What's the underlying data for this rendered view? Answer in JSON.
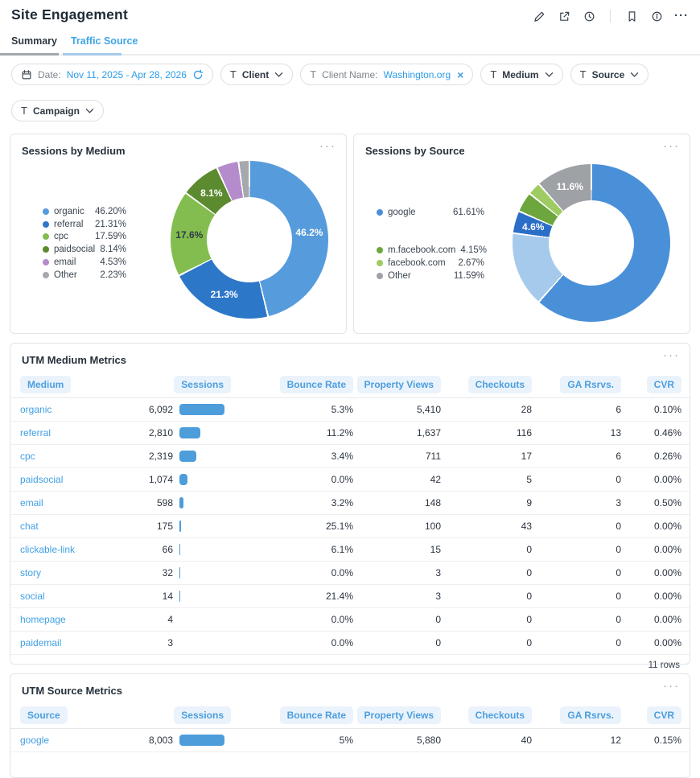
{
  "header": {
    "title": "Site Engagement",
    "more_glyph": "···"
  },
  "tabs": [
    {
      "label": "Summary",
      "active": false
    },
    {
      "label": "Traffic Source",
      "active": true
    }
  ],
  "filters": {
    "date": {
      "label": "Date:",
      "value": "Nov 11, 2025 - Apr 28, 2026"
    },
    "client": {
      "label": "Client"
    },
    "client_name": {
      "label": "Client Name:",
      "value": "Washington.org",
      "close_glyph": "×"
    },
    "medium": {
      "label": "Medium"
    },
    "source": {
      "label": "Source"
    },
    "campaign": {
      "label": "Campaign"
    },
    "text_filter_glyph": "T"
  },
  "colors": {
    "accent": "#3EA6E4",
    "link": "#3F9FE5",
    "bar_fill": "#4D9DDB",
    "bar_track": "#D9E9F7"
  },
  "chart_data": [
    {
      "type": "pie",
      "title": "Sessions by Medium",
      "legend_position": "left",
      "series": [
        {
          "name": "organic",
          "value": 46.2,
          "legend": "46.20%",
          "color": "#569CDC",
          "slice_label": "46.2%",
          "label_color": "#ffffff"
        },
        {
          "name": "referral",
          "value": 21.31,
          "legend": "21.31%",
          "color": "#2D77C9",
          "slice_label": "21.3%",
          "label_color": "#ffffff"
        },
        {
          "name": "cpc",
          "value": 17.59,
          "legend": "17.59%",
          "color": "#83BD4F",
          "slice_label": "17.6%",
          "label_color": "#2F3A45"
        },
        {
          "name": "paidsocial",
          "value": 8.14,
          "legend": "8.14%",
          "color": "#5C8A2F",
          "slice_label": "8.1%",
          "label_color": "#ffffff"
        },
        {
          "name": "email",
          "value": 4.53,
          "legend": "4.53%",
          "color": "#B48CCB"
        },
        {
          "name": "Other",
          "value": 2.23,
          "legend": "2.23%",
          "color": "#A5A8AC"
        }
      ]
    },
    {
      "type": "pie",
      "title": "Sessions by Source",
      "legend_position": "left",
      "series": [
        {
          "name": "google",
          "value": 61.61,
          "legend": "61.61%",
          "color": "#4A90D9"
        },
        {
          "name": "",
          "value": 15.38,
          "legend": "",
          "color": "#A6CAEC"
        },
        {
          "name": "",
          "value": 4.6,
          "legend": "",
          "color": "#2B6EC8",
          "slice_label": "4.6%",
          "label_color": "#ffffff"
        },
        {
          "name": "m.facebook.com",
          "value": 4.15,
          "legend": "4.15%",
          "color": "#6CA63D"
        },
        {
          "name": "facebook.com",
          "value": 2.67,
          "legend": "2.67%",
          "color": "#9ECB62"
        },
        {
          "name": "Other",
          "value": 11.59,
          "legend": "11.59%",
          "color": "#9EA1A6",
          "slice_label": "11.6%",
          "label_color": "#ffffff"
        }
      ]
    }
  ],
  "tables": [
    {
      "title": "UTM Medium Metrics",
      "columns": [
        "Medium",
        "Sessions",
        "Bounce Rate",
        "Property Views",
        "Checkouts",
        "GA Rsrvs.",
        "CVR"
      ],
      "rows": [
        [
          "organic",
          "6,092",
          "5.3%",
          "5,410",
          "28",
          "6",
          "0.10%"
        ],
        [
          "referral",
          "2,810",
          "11.2%",
          "1,637",
          "116",
          "13",
          "0.46%"
        ],
        [
          "cpc",
          "2,319",
          "3.4%",
          "711",
          "17",
          "6",
          "0.26%"
        ],
        [
          "paidsocial",
          "1,074",
          "0.0%",
          "42",
          "5",
          "0",
          "0.00%"
        ],
        [
          "email",
          "598",
          "3.2%",
          "148",
          "9",
          "3",
          "0.50%"
        ],
        [
          "chat",
          "175",
          "25.1%",
          "100",
          "43",
          "0",
          "0.00%"
        ],
        [
          "clickable-link",
          "66",
          "6.1%",
          "15",
          "0",
          "0",
          "0.00%"
        ],
        [
          "story",
          "32",
          "0.0%",
          "3",
          "0",
          "0",
          "0.00%"
        ],
        [
          "social",
          "14",
          "21.4%",
          "3",
          "0",
          "0",
          "0.00%"
        ],
        [
          "homepage",
          "4",
          "0.0%",
          "0",
          "0",
          "0",
          "0.00%"
        ],
        [
          "paidemail",
          "3",
          "0.0%",
          "0",
          "0",
          "0",
          "0.00%"
        ]
      ],
      "sessions_numeric": [
        6092,
        2810,
        2319,
        1074,
        598,
        175,
        66,
        32,
        14,
        4,
        3
      ],
      "footer": "11 rows"
    },
    {
      "title": "UTM Source Metrics",
      "columns": [
        "Source",
        "Sessions",
        "Bounce Rate",
        "Property Views",
        "Checkouts",
        "GA Rsrvs.",
        "CVR"
      ],
      "rows": [
        [
          "google",
          "8,003",
          "5%",
          "5,880",
          "40",
          "12",
          "0.15%"
        ]
      ],
      "sessions_numeric": [
        8003
      ]
    }
  ]
}
